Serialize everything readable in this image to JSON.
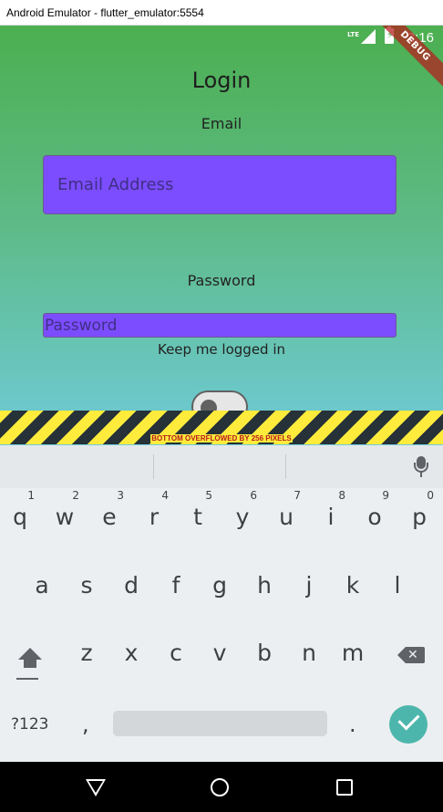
{
  "window": {
    "title": "Android Emulator - flutter_emulator:5554"
  },
  "status_bar": {
    "network": "LTE",
    "time": "3:16",
    "debug_banner": "DEBUG"
  },
  "app": {
    "title": "Login",
    "email_label": "Email",
    "email_placeholder": "Email Address",
    "password_label": "Password",
    "password_placeholder": "Password",
    "keep_logged_in_label": "Keep me logged in",
    "keep_logged_in_value": false,
    "overflow_message": "BOTTOM OVERFLOWED BY 256 PIXELS",
    "colors": {
      "gradient_top": "#4caf50",
      "gradient_bottom": "#6fcbd8",
      "field": "#7c4dff",
      "overflow_text": "#b71c1c"
    }
  },
  "keyboard": {
    "row1": [
      {
        "l": "q",
        "h": "1"
      },
      {
        "l": "w",
        "h": "2"
      },
      {
        "l": "e",
        "h": "3"
      },
      {
        "l": "r",
        "h": "4"
      },
      {
        "l": "t",
        "h": "5"
      },
      {
        "l": "y",
        "h": "6"
      },
      {
        "l": "u",
        "h": "7"
      },
      {
        "l": "i",
        "h": "8"
      },
      {
        "l": "o",
        "h": "9"
      },
      {
        "l": "p",
        "h": "0"
      }
    ],
    "row2": [
      "a",
      "s",
      "d",
      "f",
      "g",
      "h",
      "j",
      "k",
      "l"
    ],
    "row3": [
      "z",
      "x",
      "c",
      "v",
      "b",
      "n",
      "m"
    ],
    "symbols_key": "?123",
    "comma_key": ",",
    "period_key": ".",
    "icons": {
      "shift": "shift-icon",
      "backspace": "backspace-icon",
      "enter": "checkmark-icon",
      "mic": "microphone-icon"
    },
    "accent_color": "#4db6ac"
  },
  "nav_bar": {
    "icons": [
      "back-triangle-icon",
      "home-circle-icon",
      "recents-square-icon"
    ]
  }
}
